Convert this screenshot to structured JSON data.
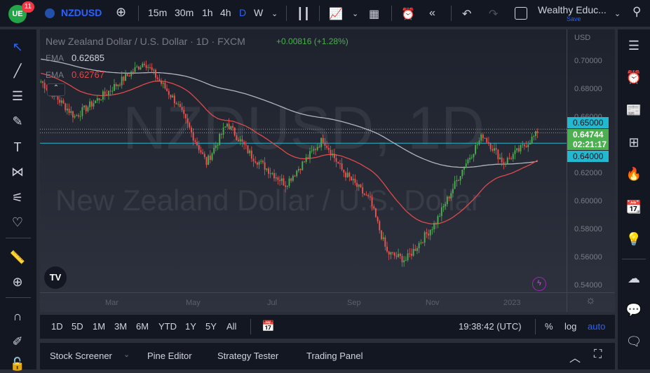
{
  "topbar": {
    "badge": "11",
    "symbol": "NZDUSD",
    "intervals": [
      "15m",
      "30m",
      "1h",
      "4h",
      "D",
      "W"
    ],
    "active_interval": "D",
    "layout_name": "Wealthy Educ...",
    "save": "Save"
  },
  "legend": {
    "title": "New Zealand Dollar / U.S. Dollar · 1D · FXCM",
    "change": "+0.00816 (+1.28%)",
    "ema1_label": "EMA",
    "ema1_value": "0.62685",
    "ema2_label": "EMA",
    "ema2_value": "0.62767"
  },
  "watermark": {
    "line1": "NZDUSD, 1D",
    "line2": "New Zealand Dollar / U.S. Dollar"
  },
  "price_axis": {
    "currency": "USD",
    "labels": [
      "0.70000",
      "0.68000",
      "0.66000",
      "0.62000",
      "0.60000",
      "0.58000",
      "0.56000",
      "0.54000"
    ],
    "tag_upper": "0.65000",
    "tag_price": "0.64744",
    "tag_countdown": "02:21:17",
    "tag_lower": "0.64000"
  },
  "time_axis": [
    "Mar",
    "May",
    "Jul",
    "Sep",
    "Nov",
    "2023"
  ],
  "ranges": [
    "1D",
    "5D",
    "1M",
    "3M",
    "6M",
    "YTD",
    "1Y",
    "5Y",
    "All"
  ],
  "clock": "19:38:42 (UTC)",
  "scale": {
    "percent": "%",
    "log": "log",
    "auto": "auto"
  },
  "panels": [
    "Stock Screener",
    "Pine Editor",
    "Strategy Tester",
    "Trading Panel"
  ],
  "colors": {
    "up": "#26a69a",
    "upbar": "#4caf50",
    "down": "#ef5350",
    "ema_slow": "#b2b5be",
    "ema_fast": "#e04a4a",
    "cyan": "#22b8cf",
    "accent": "#2962ff"
  },
  "chart_data": {
    "type": "candlestick",
    "symbol": "NZDUSD",
    "ylim": [
      0.535,
      0.712
    ],
    "last": 0.64744,
    "levels": [
      0.64,
      0.65
    ],
    "path": [
      [
        0,
        0.684
      ],
      [
        18,
        0.659
      ],
      [
        35,
        0.676
      ],
      [
        55,
        0.698
      ],
      [
        72,
        0.669
      ],
      [
        88,
        0.626
      ],
      [
        99,
        0.654
      ],
      [
        112,
        0.631
      ],
      [
        130,
        0.611
      ],
      [
        150,
        0.643
      ],
      [
        160,
        0.621
      ],
      [
        175,
        0.599
      ],
      [
        184,
        0.562
      ],
      [
        194,
        0.557
      ],
      [
        210,
        0.584
      ],
      [
        225,
        0.624
      ],
      [
        235,
        0.646
      ],
      [
        246,
        0.626
      ],
      [
        255,
        0.636
      ],
      [
        264,
        0.647
      ]
    ]
  }
}
